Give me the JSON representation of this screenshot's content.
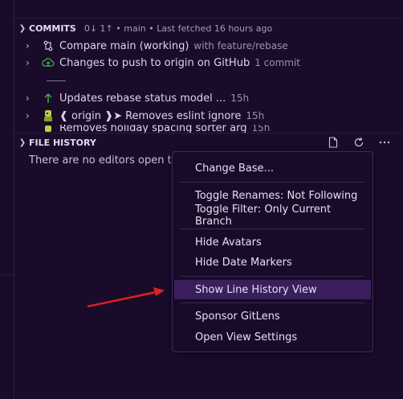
{
  "commits": {
    "header": "COMMITS",
    "status": "0↓ 1↑ • main • Last fetched 16 hours ago",
    "rows": [
      {
        "label": "Compare main (working)",
        "desc": "with feature/rebase",
        "icon": "compare-icon"
      },
      {
        "label": "Changes to push to origin on GitHub",
        "desc": "1 commit",
        "icon": "cloud-upload-icon"
      },
      {
        "label": "Updates rebase status model ...",
        "desc": "15h",
        "icon": "arrow-up-icon"
      },
      {
        "label": "❰ origin ❱➤  Removes eslint ignore",
        "desc": "15h",
        "icon": "avatar-icon"
      },
      {
        "label": "Removes holiday spacing sorter arg",
        "desc": "15h",
        "icon": "avatar-icon"
      }
    ]
  },
  "file_history": {
    "header": "FILE HISTORY",
    "empty_text": "There are no editors open that c"
  },
  "menu": {
    "items": [
      {
        "label": "Change Base..."
      },
      {
        "label": "Toggle Renames: Not Following"
      },
      {
        "label": "Toggle Filter: Only Current Branch"
      },
      {
        "label": "Hide Avatars"
      },
      {
        "label": "Hide Date Markers"
      },
      {
        "label": "Show Line History View",
        "selected": true
      },
      {
        "label": "Sponsor GitLens"
      },
      {
        "label": "Open View Settings"
      }
    ]
  },
  "colors": {
    "background": "#1a0b2b",
    "menu_selected": "#3a1f5c",
    "arrow": "#e02020",
    "push_icon": "#3fb950"
  }
}
